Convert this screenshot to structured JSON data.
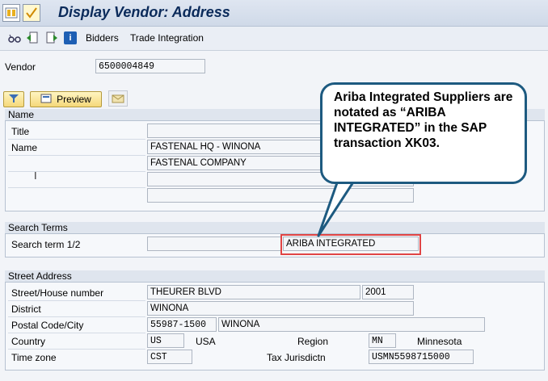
{
  "window": {
    "title": "Display Vendor: Address"
  },
  "toolbar": {
    "bidders": "Bidders",
    "trade_integration": "Trade Integration"
  },
  "vendor": {
    "label": "Vendor",
    "value": "6500004849"
  },
  "actions": {
    "preview": "Preview"
  },
  "name_section": {
    "header": "Name",
    "title_label": "Title",
    "name_label": "Name",
    "name1": "FASTENAL HQ - WINONA",
    "name2": "FASTENAL COMPANY"
  },
  "search_terms": {
    "header": "Search Terms",
    "label": "Search term 1/2",
    "term1": "",
    "term2": "ARIBA INTEGRATED"
  },
  "street_address": {
    "header": "Street Address",
    "street_label": "Street/House number",
    "street": "THEURER BLVD",
    "house_number": "2001",
    "district_label": "District",
    "district": "WINONA",
    "postal_label": "Postal Code/City",
    "postal_code": "55987-1500",
    "city": "WINONA",
    "country_label": "Country",
    "country_code": "US",
    "country_name": "USA",
    "region_label": "Region",
    "region_code": "MN",
    "region_name": "Minnesota",
    "timezone_label": "Time zone",
    "timezone": "CST",
    "tax_label": "Tax Jurisdictn",
    "tax_value": "USMN5598715000"
  },
  "callout": {
    "text": "Ariba Integrated Suppliers are notated as “ARIBA INTEGRATED” in the SAP transaction XK03."
  },
  "colors": {
    "callout_border": "#1d5a80",
    "highlight_border": "#e04444",
    "title_text": "#0a2a5a"
  }
}
